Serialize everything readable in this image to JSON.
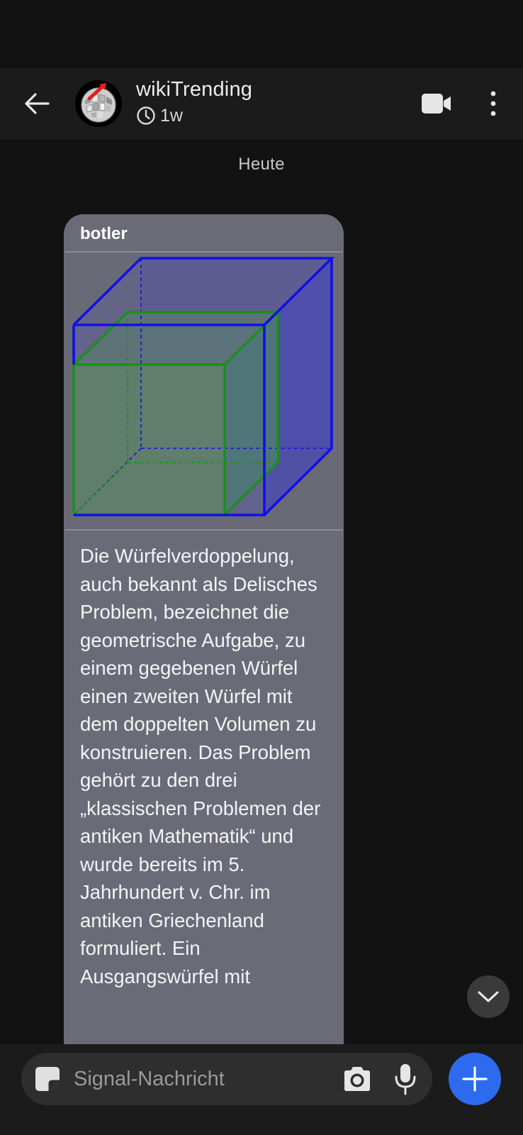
{
  "header": {
    "contact_name": "wikiTrending",
    "disappearing_timer": "1w"
  },
  "date_divider": "Heute",
  "message": {
    "sender": "botler",
    "image_description_name": "cube-doubling-illustration",
    "text": "Die Würfelverdoppelung, auch bekannt als Delisches Problem, bezeichnet die geometrische Aufgabe, zu einem gegebenen Würfel einen zweiten Würfel mit dem doppelten Volumen zu konstruieren. Das Problem gehört zu den drei „klassischen Problemen der antiken Mathematik“ und wurde bereits im 5. Jahrhundert v. Chr. im antiken Griechenland formuliert. Ein Ausgangswürfel mit"
  },
  "composer": {
    "placeholder": "Signal-Nachricht"
  },
  "colors": {
    "background": "#121212",
    "bar_background": "#1b1b1b",
    "bubble": "#6b6b78",
    "accent_blue": "#2c6bed",
    "cube_small": "#1a8f1a",
    "cube_large": "#1010e6"
  },
  "icons": {
    "back": "arrow-left-icon",
    "timer": "clock-icon",
    "video": "video-camera-icon",
    "more": "more-vertical-icon",
    "scroll": "chevron-down-icon",
    "sticker": "sticker-icon",
    "camera": "camera-icon",
    "mic": "microphone-icon",
    "add": "plus-icon"
  }
}
